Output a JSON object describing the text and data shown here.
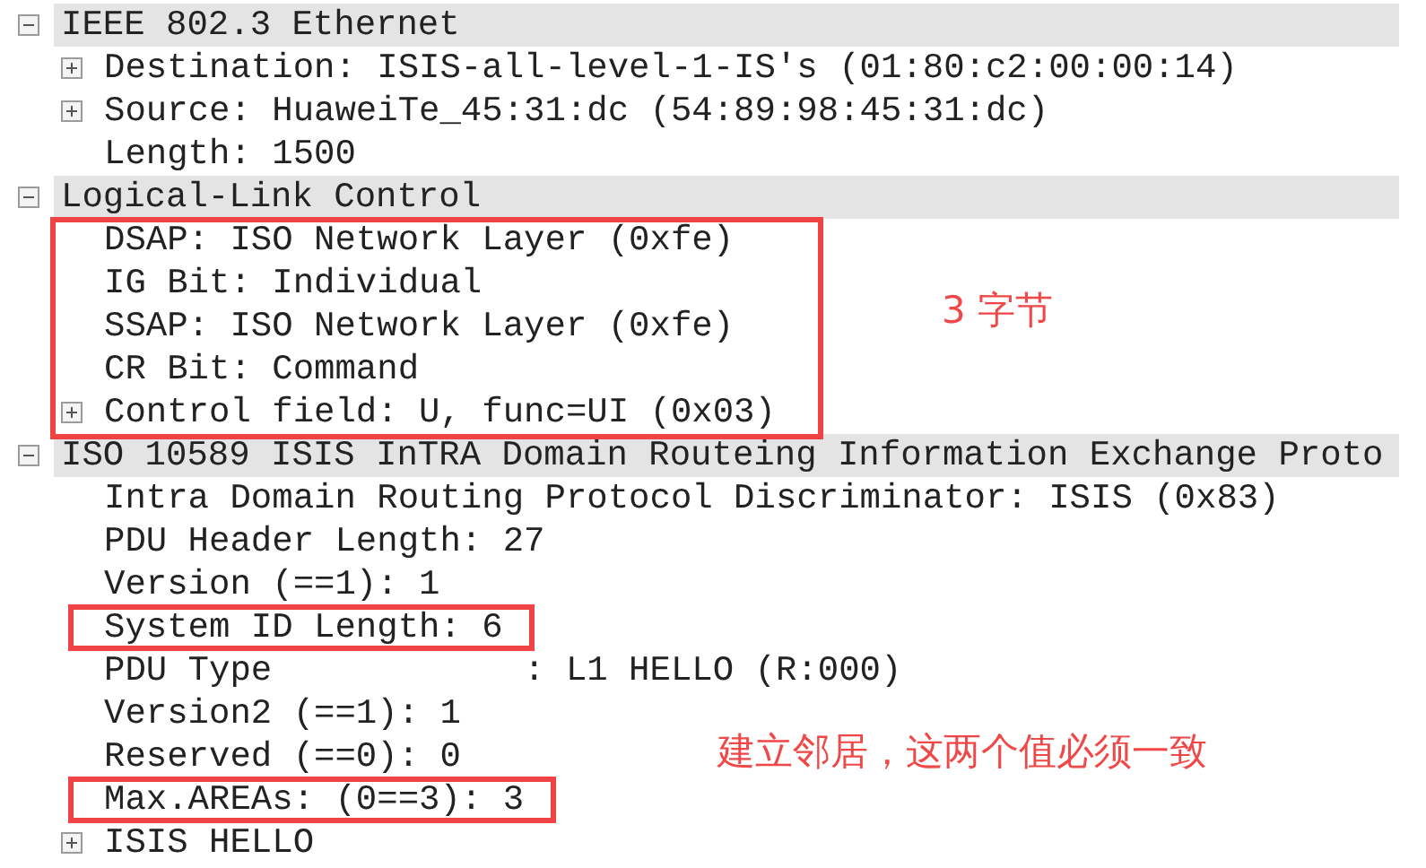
{
  "tree": [
    {
      "label": "IEEE 802.3 Ethernet",
      "expanded": true,
      "children": [
        {
          "label": "Destination: ISIS-all-level-1-IS's (01:80:c2:00:00:14)",
          "expanded": false
        },
        {
          "label": "Source: HuaweiTe_45:31:dc (54:89:98:45:31:dc)",
          "expanded": false
        },
        {
          "label": "Length: 1500"
        }
      ]
    },
    {
      "label": "Logical-Link Control",
      "expanded": true,
      "highlighted": true,
      "note": "3 字节",
      "children": [
        {
          "label": "DSAP: ISO Network Layer (0xfe)"
        },
        {
          "label": "IG Bit: Individual"
        },
        {
          "label": "SSAP: ISO Network Layer (0xfe)"
        },
        {
          "label": "CR Bit: Command"
        },
        {
          "label": "Control field: U, func=UI (0x03)",
          "expanded": false
        }
      ]
    },
    {
      "label": "ISO 10589 ISIS InTRA Domain Routeing Information Exchange Proto",
      "expanded": true,
      "note": "建立邻居，这两个值必须一致",
      "children": [
        {
          "label": "Intra Domain Routing Protocol Discriminator: ISIS (0x83)"
        },
        {
          "label": "PDU Header Length: 27"
        },
        {
          "label": "Version (==1): 1"
        },
        {
          "label": "System ID Length: 6",
          "highlighted": true
        },
        {
          "label": "PDU Type            : L1 HELLO (R:000)"
        },
        {
          "label": "Version2 (==1): 1"
        },
        {
          "label": "Reserved (==0): 0"
        },
        {
          "label": "Max.AREAs: (0==3): 3",
          "highlighted": true
        },
        {
          "label": "ISIS HELLO",
          "expanded": false
        }
      ]
    }
  ]
}
